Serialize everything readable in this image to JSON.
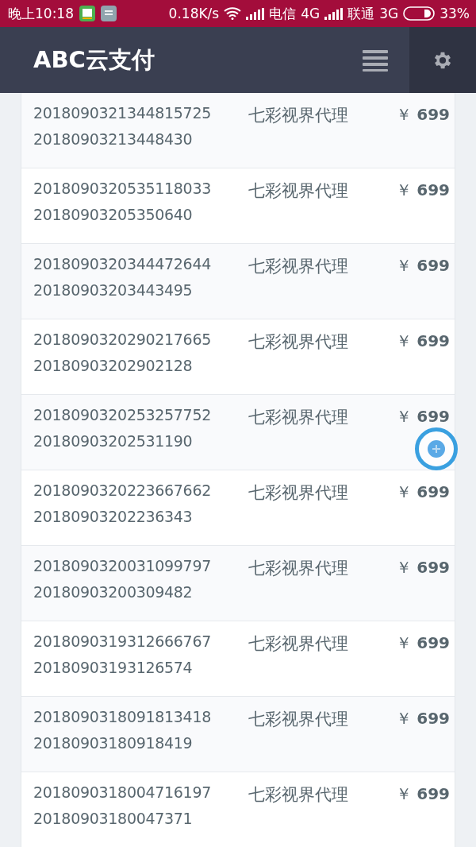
{
  "status_bar": {
    "time": "晚上10:18",
    "speed": "0.18K/s",
    "carrier_1": "电信",
    "network_1": "4G",
    "carrier_2": "联通",
    "network_2": "3G",
    "battery": "33%"
  },
  "header": {
    "title": "ABC云支付"
  },
  "orders": [
    {
      "order_no": "2018090321344815725",
      "trade_no": "20180903213448430",
      "name": "七彩视界代理",
      "currency": "￥",
      "amount": "699"
    },
    {
      "order_no": "2018090320535118033",
      "trade_no": "20180903205350640",
      "name": "七彩视界代理",
      "currency": "￥",
      "amount": "699"
    },
    {
      "order_no": "2018090320344472644",
      "trade_no": "20180903203443495",
      "name": "七彩视界代理",
      "currency": "￥",
      "amount": "699"
    },
    {
      "order_no": "2018090320290217665",
      "trade_no": "20180903202902128",
      "name": "七彩视界代理",
      "currency": "￥",
      "amount": "699"
    },
    {
      "order_no": "2018090320253257752",
      "trade_no": "20180903202531190",
      "name": "七彩视界代理",
      "currency": "￥",
      "amount": "699"
    },
    {
      "order_no": "2018090320223667662",
      "trade_no": "20180903202236343",
      "name": "七彩视界代理",
      "currency": "￥",
      "amount": "699"
    },
    {
      "order_no": "2018090320031099797",
      "trade_no": "20180903200309482",
      "name": "七彩视界代理",
      "currency": "￥",
      "amount": "699"
    },
    {
      "order_no": "2018090319312666767",
      "trade_no": "20180903193126574",
      "name": "七彩视界代理",
      "currency": "￥",
      "amount": "699"
    },
    {
      "order_no": "2018090318091813418",
      "trade_no": "20180903180918419",
      "name": "七彩视界代理",
      "currency": "￥",
      "amount": "699"
    },
    {
      "order_no": "2018090318004716197",
      "trade_no": "20180903180047371",
      "name": "七彩视界代理",
      "currency": "￥",
      "amount": "699"
    }
  ]
}
